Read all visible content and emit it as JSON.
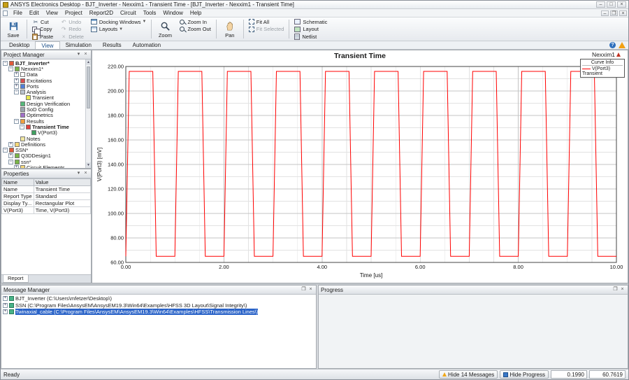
{
  "titlebar": {
    "title": "ANSYS Electronics Desktop - BJT_Inverter - Nexxim1 - Transient Time - [BJT_Inverter - Nexxim1 - Transient Time]"
  },
  "menubar": {
    "items": [
      "File",
      "Edit",
      "View",
      "Project",
      "Report2D",
      "Circuit",
      "Tools",
      "Window",
      "Help"
    ]
  },
  "toolbar": {
    "save": "Save",
    "cut": "Cut",
    "copy": "Copy",
    "paste": "Paste",
    "undo": "Undo",
    "redo": "Redo",
    "delete": "Delete",
    "docking": "Docking Windows",
    "layouts": "Layouts",
    "zoom": "Zoom",
    "zoom_in": "Zoom In",
    "zoom_out": "Zoom Out",
    "pan": "Pan",
    "fit_all": "Fit All",
    "fit_selected": "Fit Selected",
    "schematic": "Schematic",
    "layout": "Layout",
    "netlist": "Netlist"
  },
  "ribbon_tabs": {
    "items": [
      "Desktop",
      "View",
      "Simulation",
      "Results",
      "Automation"
    ],
    "active": "View"
  },
  "project_manager": {
    "title": "Project Manager",
    "tree": [
      {
        "label": "BJT_Inverter*",
        "depth": 0,
        "expander": "minus",
        "icon": "project",
        "bold": true
      },
      {
        "label": "Nexxim1*",
        "depth": 1,
        "expander": "minus",
        "icon": "design",
        "bold": false
      },
      {
        "label": "Data",
        "depth": 2,
        "expander": "plus",
        "icon": "data",
        "bold": false
      },
      {
        "label": "Excitations",
        "depth": 2,
        "expander": "plus",
        "icon": "excitations",
        "bold": false
      },
      {
        "label": "Ports",
        "depth": 2,
        "expander": "plus",
        "icon": "ports",
        "bold": false
      },
      {
        "label": "Analysis",
        "depth": 2,
        "expander": "minus",
        "icon": "analysis",
        "bold": false
      },
      {
        "label": "Transient",
        "depth": 3,
        "expander": "none",
        "icon": "transient",
        "bold": false
      },
      {
        "label": "Design Verification",
        "depth": 2,
        "expander": "none",
        "icon": "verification",
        "bold": false
      },
      {
        "label": "SoD Config",
        "depth": 2,
        "expander": "none",
        "icon": "sod",
        "bold": false
      },
      {
        "label": "Optimetrics",
        "depth": 2,
        "expander": "none",
        "icon": "optimetrics",
        "bold": false
      },
      {
        "label": "Results",
        "depth": 2,
        "expander": "minus",
        "icon": "results",
        "bold": false
      },
      {
        "label": "Transient Time",
        "depth": 3,
        "expander": "minus",
        "icon": "report",
        "bold": true
      },
      {
        "label": "V(Port3)",
        "depth": 4,
        "expander": "none",
        "icon": "trace",
        "bold": false
      },
      {
        "label": "Notes",
        "depth": 2,
        "expander": "none",
        "icon": "notes",
        "bold": false
      },
      {
        "label": "Definitions",
        "depth": 1,
        "expander": "plus",
        "icon": "definitions",
        "bold": false
      },
      {
        "label": "SSN*",
        "depth": 0,
        "expander": "minus",
        "icon": "project",
        "bold": false
      },
      {
        "label": "Q3DDesign1",
        "depth": 1,
        "expander": "plus",
        "icon": "design",
        "bold": false
      },
      {
        "label": "ssn*",
        "depth": 1,
        "expander": "minus",
        "icon": "design",
        "bold": false
      },
      {
        "label": "Circuit Elements",
        "depth": 2,
        "expander": "plus",
        "icon": "folder",
        "bold": false
      }
    ]
  },
  "properties": {
    "title": "Properties",
    "headers": [
      "Name",
      "Value"
    ],
    "rows": [
      [
        "Name",
        "Transient Time"
      ],
      [
        "Report Type",
        "Standard"
      ],
      [
        "Display Ty...",
        "Rectangular Plot"
      ],
      [
        "V(Port3)",
        "Time, V(Port3)"
      ]
    ],
    "tab": "Report"
  },
  "chart": {
    "title": "Transient Time",
    "design_label": "Nexxim1",
    "legend": {
      "header": "Curve Info",
      "series": "V(Port3)",
      "sub": "Transient"
    }
  },
  "chart_data": {
    "type": "line",
    "title": "Transient Time",
    "xlabel": "Time [us]",
    "ylabel": "V(Port3) [mV]",
    "xlim": [
      0,
      10
    ],
    "ylim": [
      60,
      220
    ],
    "xticks": [
      0,
      2,
      4,
      6,
      8,
      10
    ],
    "yticks": [
      60,
      80,
      100,
      120,
      140,
      160,
      180,
      200,
      220
    ],
    "x_minor_step": 0.5,
    "y_minor_step": 10,
    "grid": true,
    "legend_position": "top-right",
    "series": [
      {
        "name": "V(Port3)",
        "color": "#ff0000",
        "points": [
          [
            0,
            65
          ],
          [
            0.07,
            216
          ],
          [
            0.55,
            216
          ],
          [
            0.62,
            65
          ],
          [
            1,
            65
          ],
          [
            1.07,
            216
          ],
          [
            1.55,
            216
          ],
          [
            1.62,
            65
          ],
          [
            2,
            65
          ],
          [
            2.07,
            216
          ],
          [
            2.55,
            216
          ],
          [
            2.62,
            65
          ],
          [
            3,
            65
          ],
          [
            3.07,
            216
          ],
          [
            3.55,
            216
          ],
          [
            3.62,
            65
          ],
          [
            4,
            65
          ],
          [
            4.07,
            216
          ],
          [
            4.55,
            216
          ],
          [
            4.62,
            65
          ],
          [
            5,
            65
          ],
          [
            5.07,
            216
          ],
          [
            5.55,
            216
          ],
          [
            5.62,
            65
          ],
          [
            6,
            65
          ],
          [
            6.07,
            216
          ],
          [
            6.55,
            216
          ],
          [
            6.62,
            65
          ],
          [
            7,
            65
          ],
          [
            7.07,
            216
          ],
          [
            7.55,
            216
          ],
          [
            7.62,
            65
          ],
          [
            8,
            65
          ],
          [
            8.07,
            216
          ],
          [
            8.55,
            216
          ],
          [
            8.62,
            65
          ],
          [
            9,
            65
          ],
          [
            9.07,
            216
          ],
          [
            9.55,
            216
          ],
          [
            9.62,
            65
          ],
          [
            10,
            65
          ]
        ]
      }
    ]
  },
  "message_manager": {
    "title": "Message Manager",
    "items": [
      {
        "label": "BJT_Inverter (C:\\Users\\mfetzer\\Desktop\\)",
        "selected": false
      },
      {
        "label": "SSN (C:\\Program Files\\AnsysEM\\AnsysEM19.3\\Win64\\Examples\\HFSS 3D Layout\\Signal Integrity\\)",
        "selected": false
      },
      {
        "label": "Twinaxial_cable (C:\\Program Files\\AnsysEM\\AnsysEM19.3\\Win64\\Examples\\HFSS\\Transmission Lines\\)",
        "selected": true
      }
    ]
  },
  "progress": {
    "title": "Progress"
  },
  "statusbar": {
    "ready": "Ready",
    "hide_messages": "Hide 14 Messages",
    "hide_progress": "Hide Progress",
    "coord_x": "0.1990",
    "coord_y": "60.7619"
  }
}
